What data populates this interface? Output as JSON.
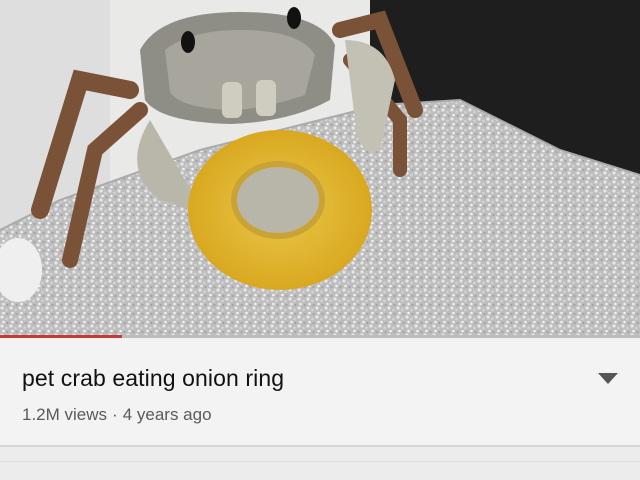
{
  "video": {
    "progress": 0.19,
    "accent_color": "#c43b3b"
  },
  "info": {
    "title": "pet crab eating onion ring",
    "views": "1.2M views",
    "separator": "·",
    "age": "4 years ago",
    "expand_icon": "chevron-down-icon"
  }
}
